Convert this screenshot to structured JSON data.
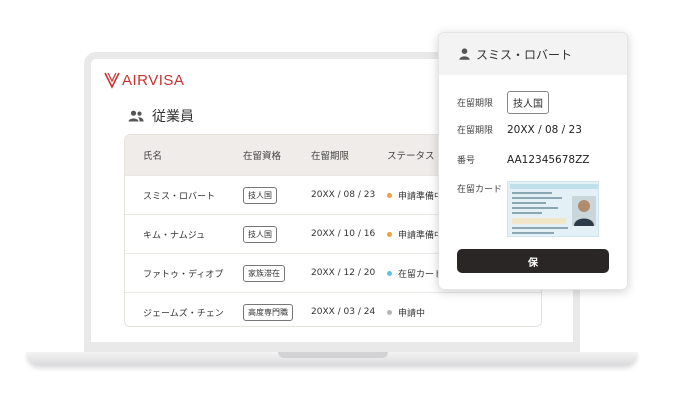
{
  "app": {
    "logo_text": "AIRVISA"
  },
  "page": {
    "title": "従業員"
  },
  "table": {
    "headers": [
      "氏名",
      "在留資格",
      "在留期限",
      "ステータス"
    ],
    "rows": [
      {
        "name": "スミス・ロバート",
        "status_type": "技人国",
        "expiry": "20XX / 08 / 23",
        "status": "申請準備中"
      },
      {
        "name": "キム・ナムジュ",
        "status_type": "技人国",
        "expiry": "20XX / 10 / 16",
        "status": "申請準備中"
      },
      {
        "name": "ファトゥ・ディオプ",
        "status_type": "家族滞在",
        "expiry": "20XX / 12 / 20",
        "status": "在留カード"
      },
      {
        "name": "ジェームズ・チェン",
        "status_type": "高度専門職",
        "expiry": "20XX / 03 / 24",
        "status": "申請中"
      }
    ]
  },
  "detail": {
    "name": "スミス・ロバート",
    "fields": [
      {
        "label": "在留期限",
        "value": "技人国"
      },
      {
        "label": "在留期限",
        "value": "20XX / 08 / 23"
      },
      {
        "label": "番号",
        "value": "AA12345678ZZ"
      },
      {
        "label": "在留カード"
      }
    ],
    "save_label": "保"
  },
  "colors": {
    "brand": "#c8312f",
    "status_preparing": "#f0a03c",
    "status_card": "#5bc3e6",
    "status_applying": "#b5b5b5",
    "button_bg": "#2a2625"
  },
  "icons": {
    "people": "people-icon",
    "person": "person-icon"
  }
}
